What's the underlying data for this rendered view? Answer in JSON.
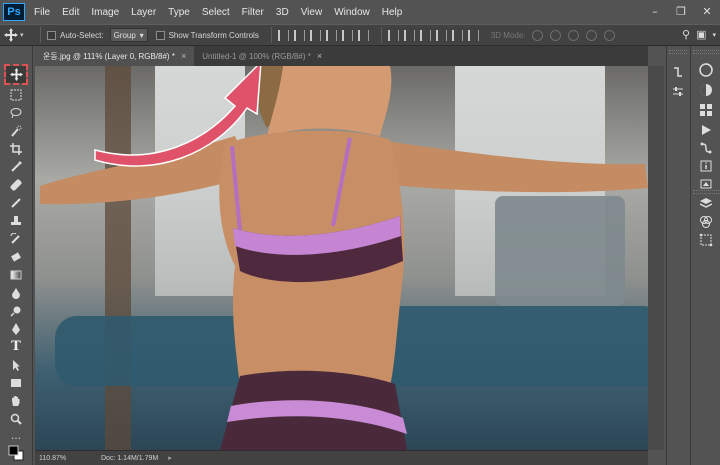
{
  "app": {
    "logo": "Ps"
  },
  "menu": [
    "File",
    "Edit",
    "Image",
    "Layer",
    "Type",
    "Select",
    "Filter",
    "3D",
    "View",
    "Window",
    "Help"
  ],
  "options": {
    "auto_select_label": "Auto-Select:",
    "auto_select_value": "Group",
    "show_transform_label": "Show Transform Controls",
    "mode_3d_label": "3D Mode:"
  },
  "tabs": [
    {
      "label": "운동.jpg @ 111% (Layer 0, RGB/8#) *",
      "active": true
    },
    {
      "label": "Untitled-1 @ 100% (RGB/8#) *",
      "active": false
    }
  ],
  "status": {
    "zoom": "110.87%",
    "doc": "Doc: 1.14M/1.79M"
  },
  "tools": [
    "move-icon",
    "marquee-icon",
    "lasso-icon",
    "quick-select-icon",
    "crop-icon",
    "eyedropper-icon",
    "healing-brush-icon",
    "brush-icon",
    "clone-stamp-icon",
    "history-brush-icon",
    "eraser-icon",
    "gradient-icon",
    "blur-icon",
    "dodge-icon",
    "pen-icon",
    "type-icon",
    "path-select-icon",
    "rectangle-icon",
    "hand-icon",
    "zoom-icon",
    "more-tools-icon",
    "color-swatch-icon"
  ],
  "colors": {
    "accent": "#31a8ff",
    "annotation_arrow": "#e0526a",
    "active_outline": "#e05252"
  }
}
